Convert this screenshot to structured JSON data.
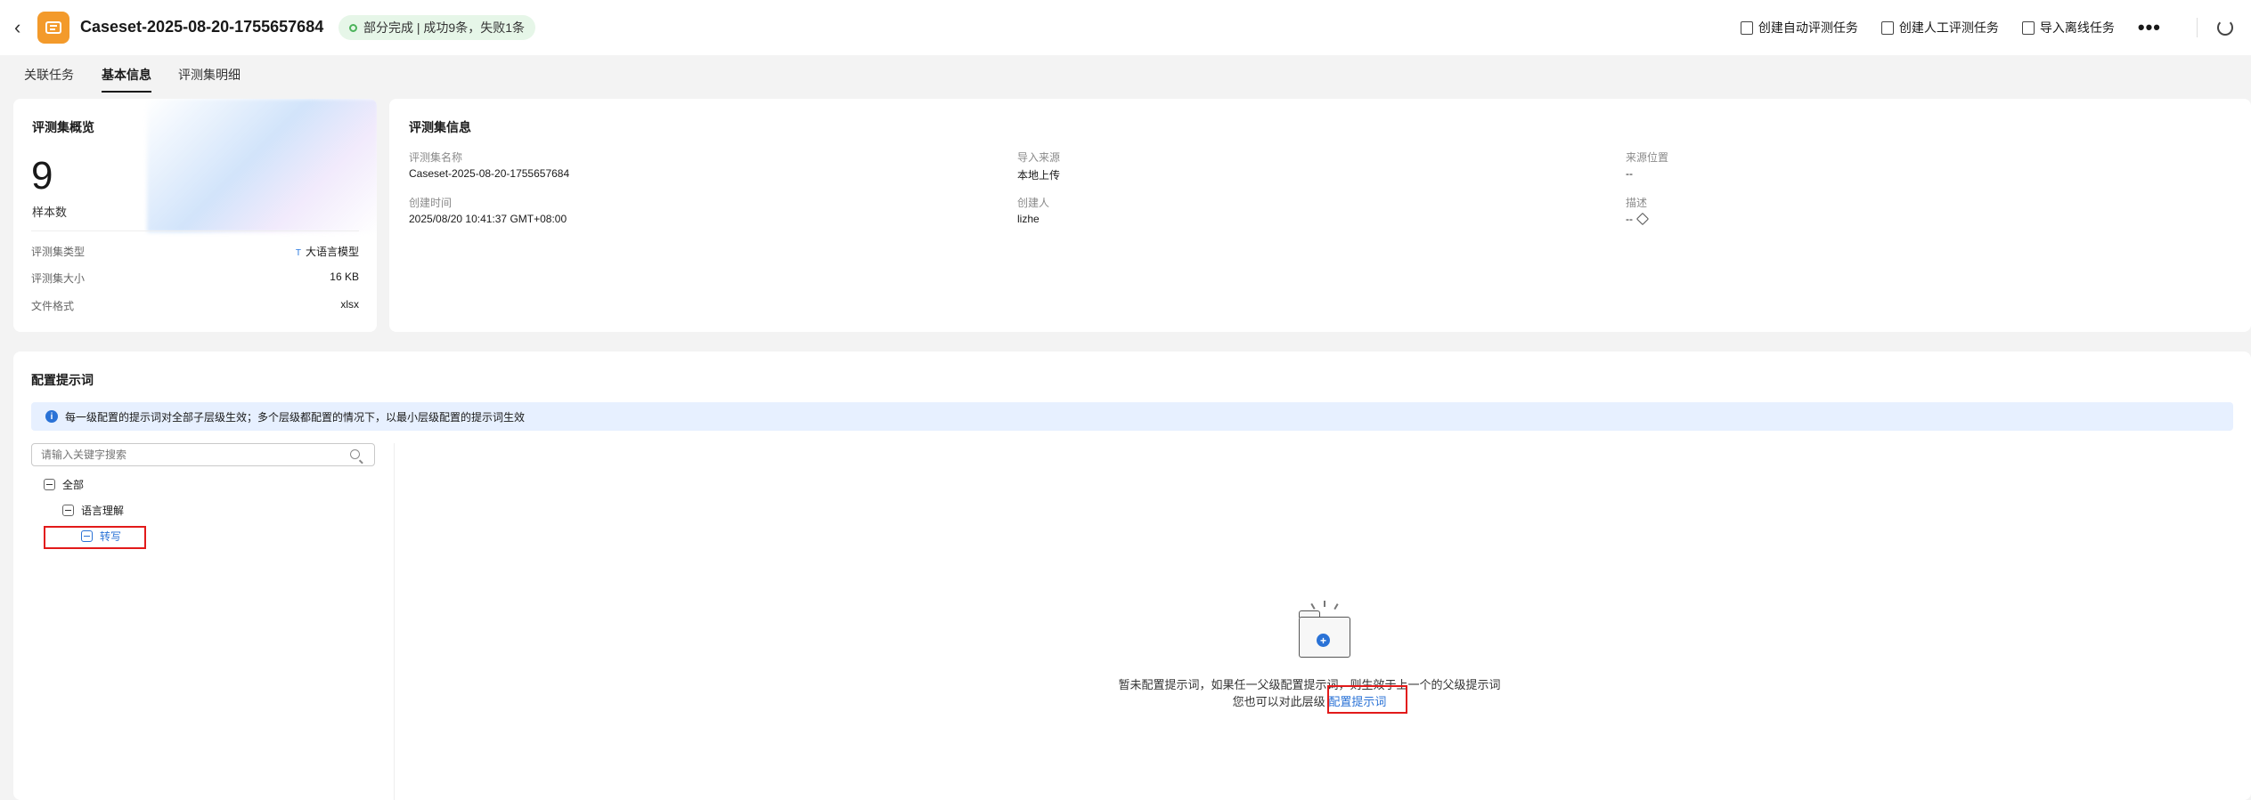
{
  "header": {
    "back_icon": "chevron-left-icon",
    "title": "Caseset-2025-08-20-1755657684",
    "status": "部分完成 | 成功9条，失败1条",
    "actions": [
      {
        "label": "创建自动评测任务",
        "icon": "clipboard-icon"
      },
      {
        "label": "创建人工评测任务",
        "icon": "clipboard-user-icon"
      },
      {
        "label": "导入离线任务",
        "icon": "import-icon"
      }
    ],
    "more": "•••"
  },
  "tabs": [
    {
      "label": "关联任务",
      "active": false
    },
    {
      "label": "基本信息",
      "active": true
    },
    {
      "label": "评测集明细",
      "active": false
    }
  ],
  "overview": {
    "title": "评测集概览",
    "sample_count": "9",
    "sample_label": "样本数",
    "rows": [
      {
        "label": "评测集类型",
        "value": "大语言模型"
      },
      {
        "label": "评测集大小",
        "value": "16 KB"
      },
      {
        "label": "文件格式",
        "value": "xlsx"
      }
    ]
  },
  "info": {
    "title": "评测集信息",
    "fields": [
      {
        "label": "评测集名称",
        "value": "Caseset-2025-08-20-1755657684"
      },
      {
        "label": "导入来源",
        "value": "本地上传"
      },
      {
        "label": "来源位置",
        "value": "--"
      },
      {
        "label": "创建时间",
        "value": "2025/08/20 10:41:37 GMT+08:00"
      },
      {
        "label": "创建人",
        "value": "lizhe"
      },
      {
        "label": "描述",
        "value": "--"
      }
    ]
  },
  "prompt": {
    "title": "配置提示词",
    "banner": "每一级配置的提示词对全部子层级生效；多个层级都配置的情况下，以最小层级配置的提示词生效",
    "search_placeholder": "请输入关键字搜索",
    "tree": [
      {
        "label": "全部",
        "level": 0,
        "selected": false
      },
      {
        "label": "语言理解",
        "level": 1,
        "selected": false
      },
      {
        "label": "转写",
        "level": 2,
        "selected": true
      }
    ],
    "empty_line1": "暂未配置提示词，如果任一父级配置提示词，则生效于上一个的父级提示词",
    "empty_line2_prefix": "您也可以对此层级",
    "empty_link": "配置提示词"
  },
  "colors": {
    "accent": "#2a72d6",
    "logo": "#f39a2b",
    "status_bg": "#e6f6e8",
    "highlight": "#e21a1a"
  }
}
